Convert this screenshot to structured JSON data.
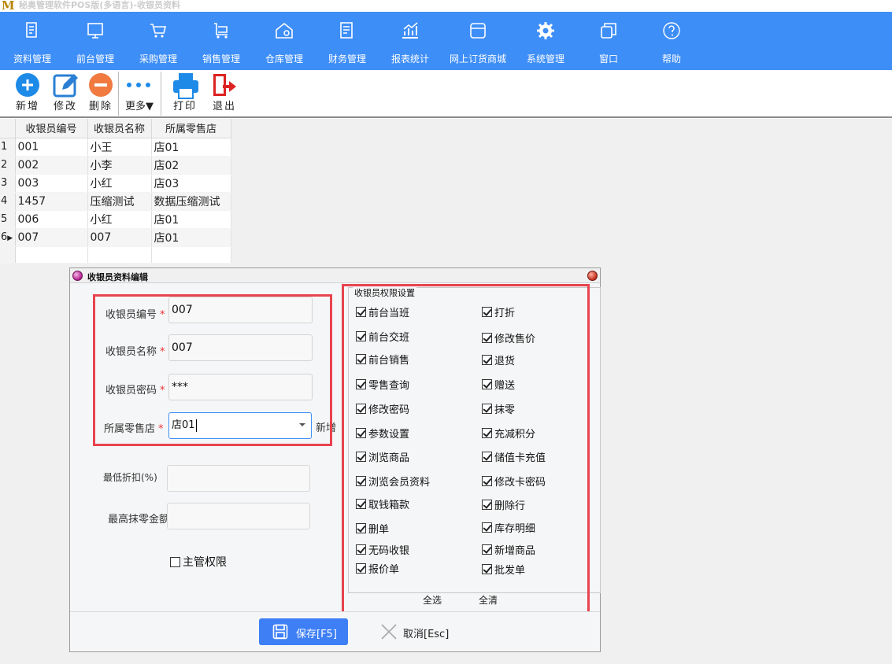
{
  "window": {
    "logo": "M",
    "title": "秘奥管理软件POS版(多语言)-收银员资料"
  },
  "nav": [
    {
      "label": "资料管理",
      "icon": "document-icon"
    },
    {
      "label": "前台管理",
      "icon": "monitor-icon"
    },
    {
      "label": "采购管理",
      "icon": "cart-icon"
    },
    {
      "label": "销售管理",
      "icon": "trolley-icon"
    },
    {
      "label": "仓库管理",
      "icon": "warehouse-icon"
    },
    {
      "label": "财务管理",
      "icon": "finance-icon"
    },
    {
      "label": "报表统计",
      "icon": "chart-icon"
    },
    {
      "label": "网上订货商城",
      "icon": "store-icon"
    },
    {
      "label": "系统管理",
      "icon": "gear-icon"
    },
    {
      "label": "窗口",
      "icon": "window-icon"
    },
    {
      "label": "帮助",
      "icon": "help-icon"
    }
  ],
  "toolbar": {
    "add": "新增",
    "edit": "修改",
    "delete": "删除",
    "more": "更多▼",
    "print": "打印",
    "exit": "退出",
    "colors": {
      "add": "#1e8ae8",
      "edit": "#2a7fd4",
      "delete": "#f07a40",
      "print": "#1e8ae8",
      "exit": "#d22"
    }
  },
  "grid": {
    "headers": [
      "收银员编号",
      "收银员名称",
      "所属零售店"
    ],
    "rows": [
      {
        "n": "1",
        "code": "001",
        "name": "小王",
        "store": "店01"
      },
      {
        "n": "2",
        "code": "002",
        "name": "小李",
        "store": "店02"
      },
      {
        "n": "3",
        "code": "003",
        "name": "小红",
        "store": "店03"
      },
      {
        "n": "4",
        "code": "1457",
        "name": "压缩测试",
        "store": "数据压缩测试"
      },
      {
        "n": "5",
        "code": "006",
        "name": "小红",
        "store": "店01"
      },
      {
        "n": "6",
        "code": "007",
        "name": "007",
        "store": "店01",
        "current": true
      }
    ],
    "current_marker": "▶"
  },
  "dialog": {
    "title": "收银员资料编辑",
    "required_mark": "*",
    "fields": {
      "code": {
        "label": "收银员编号",
        "value": "007"
      },
      "name": {
        "label": "收银员名称",
        "value": "007"
      },
      "password": {
        "label": "收银员密码",
        "value": "***"
      },
      "store": {
        "label": "所属零售店",
        "value": "店01"
      },
      "new_link": "新增",
      "min_discount": {
        "label": "最低折扣(%)",
        "value": ""
      },
      "max_round": {
        "label": "最高抹零金额",
        "value": ""
      },
      "supervisor": {
        "label": "主管权限",
        "checked": false
      }
    },
    "permissions": {
      "legend": "收银员权限设置",
      "left": [
        "前台当班",
        "前台交班",
        "前台销售",
        "零售查询",
        "修改密码",
        "参数设置",
        "浏览商品",
        "浏览会员资料",
        "取钱箱款",
        "删单",
        "无码收银",
        "报价单"
      ],
      "right": [
        "打折",
        "修改售价",
        "退货",
        "赠送",
        "抹零",
        "充减积分",
        "储值卡充值",
        "修改卡密码",
        "删除行",
        "库存明细",
        "新增商品",
        "批发单"
      ],
      "select_all": "全选",
      "clear_all": "全清"
    },
    "save": "保存[F5]",
    "cancel": "取消[Esc]"
  },
  "colors": {
    "nav_bg": "#3e8ef7",
    "highlight": "#e8434f",
    "save_bg": "#3e7ff5"
  }
}
